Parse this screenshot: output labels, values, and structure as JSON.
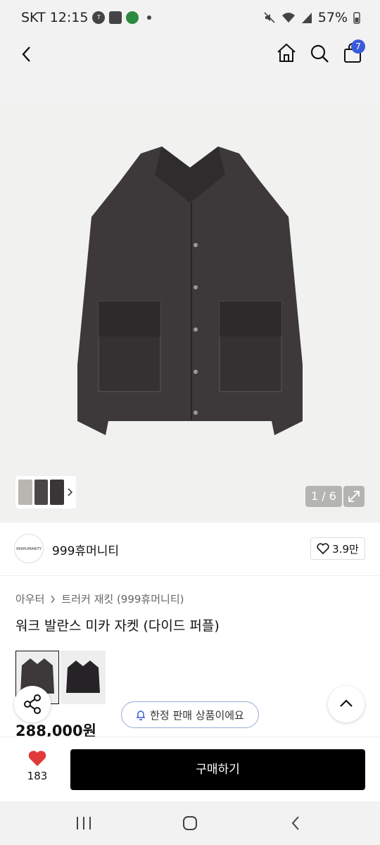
{
  "status": {
    "carrier_time": "SKT 12:15",
    "battery": "57%"
  },
  "header": {
    "cart_count": "7"
  },
  "gallery": {
    "counter": "1 / 6"
  },
  "brand": {
    "logo_text": "999HUMANITY",
    "name": "999휴머니티",
    "likes": "3.9만"
  },
  "breadcrumb": {
    "level1": "아우터",
    "level2": "트러커 재킷 (999휴머니티)"
  },
  "product": {
    "title": "워크 발란스 미카 자켓 (다이드 퍼플)",
    "limited_label": "한정 판매 상품이에요",
    "price": "288,000원"
  },
  "bottom": {
    "wish_count": "183",
    "buy_label": "구매하기"
  },
  "colors": {
    "accent_blue": "#3a5bd9",
    "heart_red": "#e03a3a",
    "buy_bg": "#000000"
  }
}
